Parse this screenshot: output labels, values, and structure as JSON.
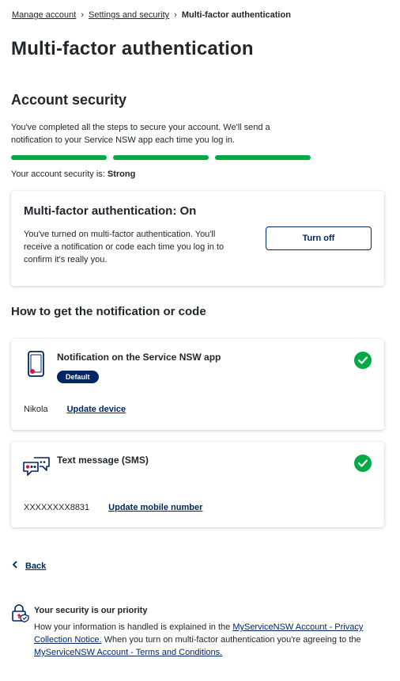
{
  "breadcrumb": {
    "items": [
      "Manage account",
      "Settings and security"
    ],
    "current": "Multi-factor authentication"
  },
  "page_title": "Multi-factor authentication",
  "account_security": {
    "title": "Account security",
    "intro": "You've completed all the steps to secure your account. We'll send a notification to your Service NSW app each time you log in.",
    "strength_prefix": "Your account security is:",
    "strength_value": "Strong",
    "strength_bars_filled": 3,
    "strength_bars_total": 3,
    "bar_color": "#00aa45"
  },
  "mfa_card": {
    "title": "Multi-factor authentication: On",
    "text": "You've turned on multi-factor authentication. You'll receive a notification or code each time you log in to confirm it's really you.",
    "button": "Turn off"
  },
  "methods": {
    "title": "How to get the notification or code",
    "app": {
      "title": "Notification on the Service NSW app",
      "badge": "Default",
      "device_name": "Nikola",
      "action": "Update device"
    },
    "sms": {
      "title": "Text message (SMS)",
      "number": "XXXXXXXX8831",
      "action": "Update mobile number"
    }
  },
  "back": {
    "label": "Back"
  },
  "notice": {
    "title": "Your security is our priority",
    "text_1": "How your information is handled is explained in the ",
    "link_1": "MyServiceNSW Account - Privacy Collection Notice.",
    "text_2": " When you turn on multi-factor authentication you're agreeing to the ",
    "link_2": "MyServiceNSW Account - Terms and Conditions."
  },
  "colors": {
    "primary_navy": "#002664",
    "success_green": "#00aa45",
    "accent_red": "#d7153a"
  },
  "icons": {
    "phone": "smartphone-notification-icon",
    "sms": "chat-bubbles-icon",
    "check": "check-circle-icon",
    "back": "chevron-left-icon",
    "notice": "padlock-shield-icon"
  }
}
